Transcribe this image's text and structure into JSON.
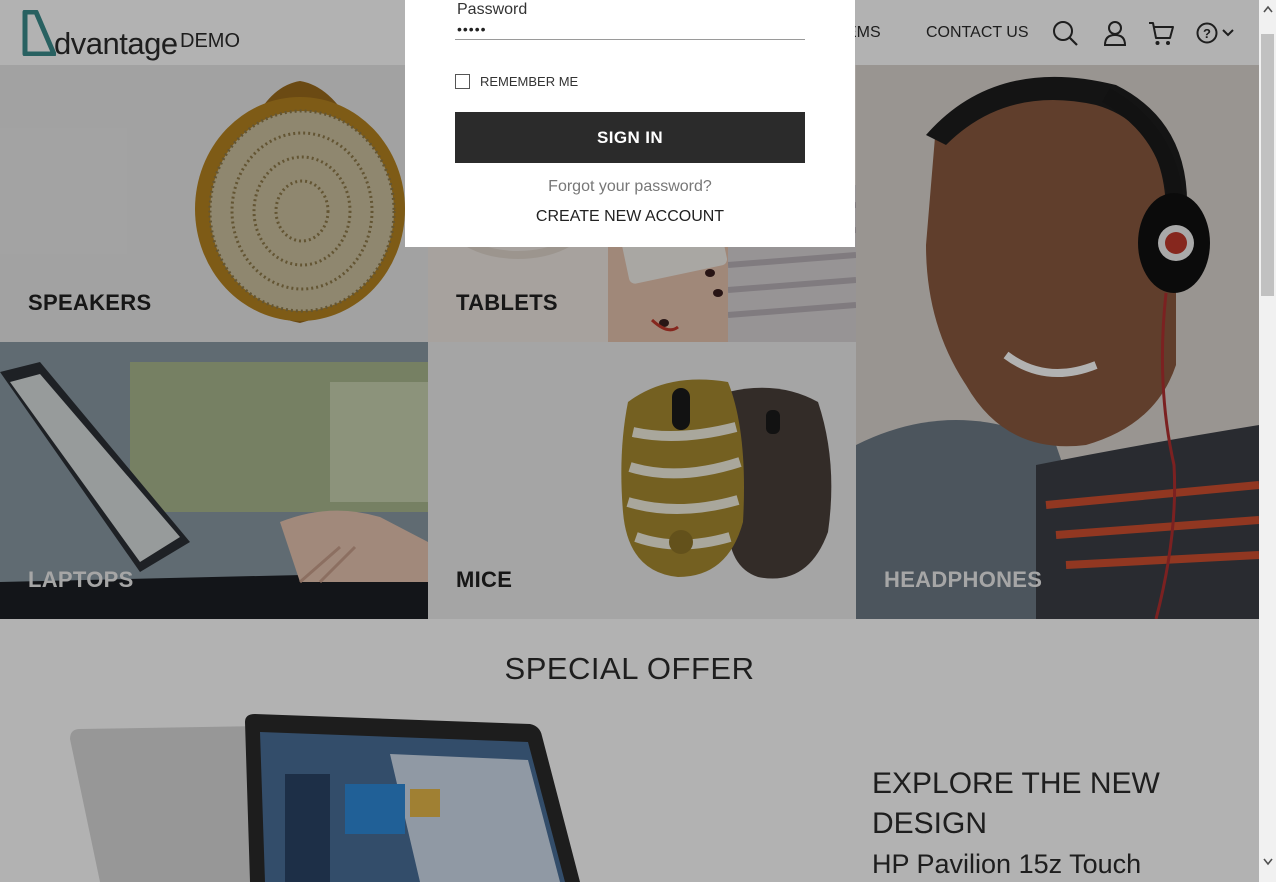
{
  "header": {
    "logo_word": "dvantage",
    "logo_demo": "DEMO",
    "nav_items_partial": "EMS",
    "nav_contact": "CONTACT US",
    "icons": [
      "search-icon",
      "user-icon",
      "cart-icon",
      "help-icon",
      "chevron-down-icon"
    ]
  },
  "categories": {
    "speakers": "SPEAKERS",
    "tablets": "TABLETS",
    "headphones": "HEADPHONES",
    "laptops": "LAPTOPS",
    "mice": "MICE"
  },
  "special_offer": {
    "title": "SPECIAL OFFER",
    "headline": "EXPLORE THE NEW DESIGN",
    "product": "HP Pavilion 15z Touch"
  },
  "login_modal": {
    "password_label": "Password",
    "password_value": "•••••",
    "remember_label": "REMEMBER ME",
    "remember_checked": false,
    "signin_label": "SIGN IN",
    "forgot_label": "Forgot your password?",
    "create_label": "CREATE NEW ACCOUNT"
  },
  "colors": {
    "brand_teal": "#3a8b8b",
    "button_dark": "#2b2b2b",
    "overlay": "rgba(0,0,0,0.30)"
  }
}
